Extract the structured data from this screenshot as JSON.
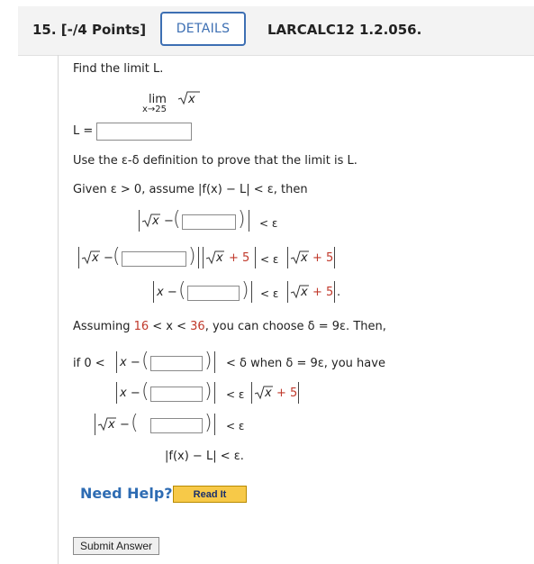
{
  "header": {
    "question_number": "15. [-/4 Points]",
    "details_label": "DETAILS",
    "code": "LARCALC12 1.2.056."
  },
  "problem": {
    "instruction": "Find the limit L.",
    "lim_word": "lim",
    "lim_sub": "x→25",
    "sqrt_x": "x",
    "l_label": "L =",
    "prove_text": "Use the ε-δ definition to prove that the limit is L.",
    "given_text": "Given ε > 0, assume |f(x) − L| < ε, then",
    "lt_eps": "< ε",
    "plus5": "+ 5",
    "assume_pre": "Assuming ",
    "assume_16": "16",
    "assume_mid": " < x < ",
    "assume_36": "36",
    "assume_post": ", you can choose δ = 9ε. Then,",
    "if_label": "if 0 <",
    "delta_text": "< δ when δ = 9ε, you have",
    "final_line": "|f(x) − L| < ε.",
    "x_minus": "x −",
    "sqrt_minus": "−",
    "lt_eps_sym": "< ε",
    "period": "."
  },
  "help": {
    "need_help": "Need Help?",
    "read_it": "Read It"
  },
  "submit_label": "Submit Answer"
}
